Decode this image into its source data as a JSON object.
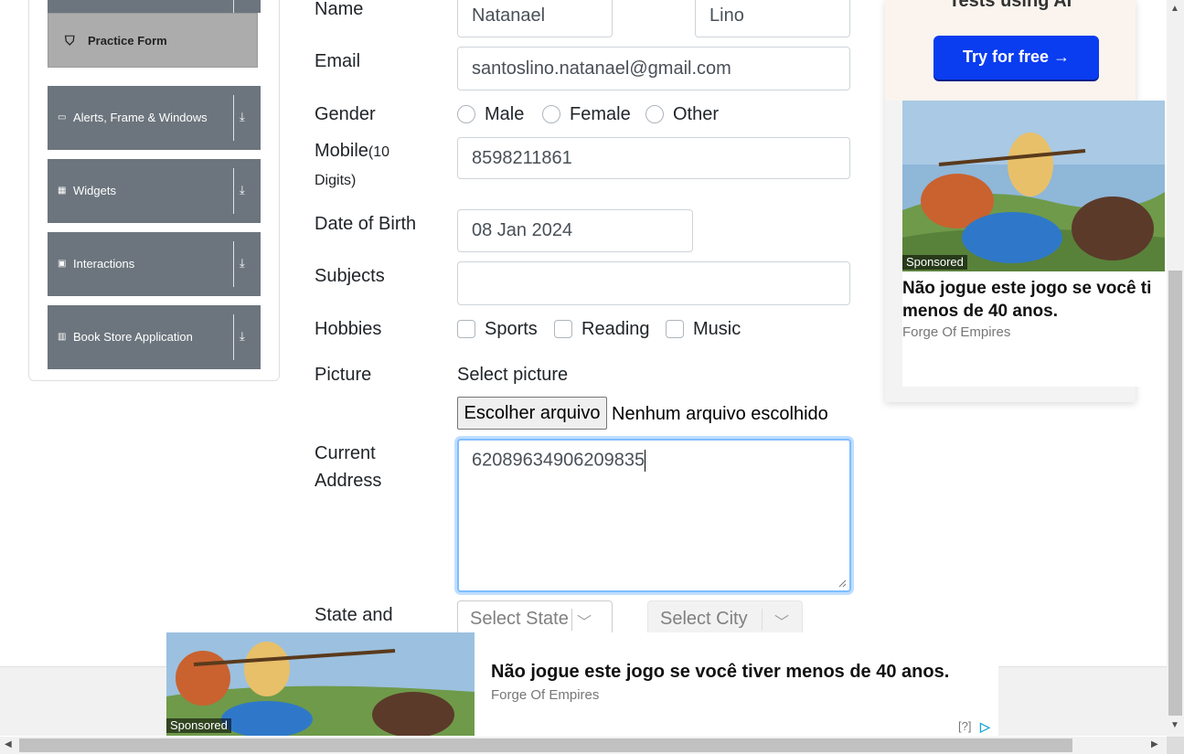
{
  "sidebar": {
    "practice_form": "Practice Form",
    "groups": [
      {
        "label": "Alerts, Frame & Windows",
        "icon": "window-icon"
      },
      {
        "label": "Widgets",
        "icon": "widgets-icon"
      },
      {
        "label": "Interactions",
        "icon": "interactions-icon"
      },
      {
        "label": "Book Store Application",
        "icon": "book-icon"
      }
    ],
    "arrow": "⤓"
  },
  "form": {
    "name_label": "Name",
    "first_name": "Natanael",
    "last_name": "Lino",
    "email_label": "Email",
    "email": "santoslino.natanael@gmail.com",
    "gender_label": "Gender",
    "genders": [
      "Male",
      "Female",
      "Other"
    ],
    "mobile_label": "Mobile",
    "mobile_hint": "(10",
    "mobile_hint2": "Digits)",
    "mobile": "8598211861",
    "dob_label": "Date of Birth",
    "dob": "08 Jan 2024",
    "subjects_label": "Subjects",
    "subjects": "",
    "hobbies_label": "Hobbies",
    "hobbies": [
      "Sports",
      "Reading",
      "Music"
    ],
    "picture_label": "Picture",
    "select_picture": "Select picture",
    "file_button": "Escolher arquivo",
    "file_status": "Nenhum arquivo escolhido",
    "address_label_1": "Current",
    "address_label_2": "Address",
    "address": "62089634906209835",
    "state_city_label": "State and",
    "state_placeholder": "Select State",
    "city_placeholder": "Select City"
  },
  "ad_right": {
    "top_text": "Tests using AI",
    "try_button": "Try for free →",
    "sponsored": "Sponsored",
    "title_1": "Não jogue este jogo se você ti",
    "title_2": "menos de 40 anos.",
    "brand": "Forge Of Empires"
  },
  "ad_bottom": {
    "sponsored": "Sponsored",
    "title": "Não jogue este jogo se você tiver menos de 40 anos.",
    "brand": "Forge Of Empires",
    "help": "[?]",
    "adchoices_icon": "▷"
  },
  "colors": {
    "sidebar_header": "#6c757d",
    "active_item": "#acacac",
    "focus_border": "#80bdff",
    "cta": "#0a3cf0"
  }
}
